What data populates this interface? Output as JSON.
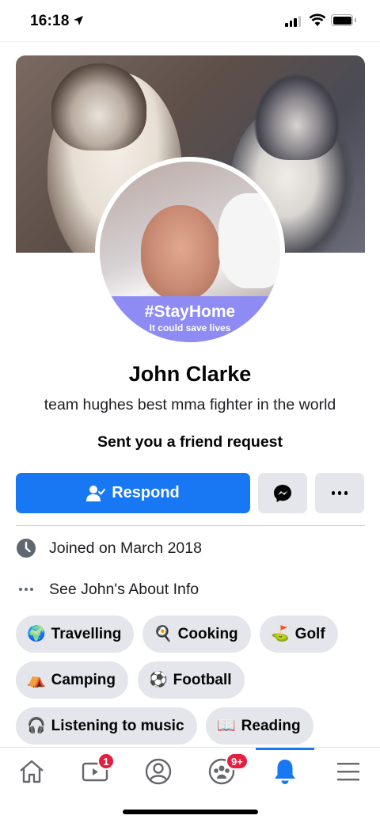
{
  "status_bar": {
    "time": "16:18"
  },
  "cover": {
    "image": "two-dogs-cover-photo"
  },
  "profile_frame": {
    "title": "#StayHome",
    "subtitle": "It could save lives"
  },
  "profile": {
    "name": "John Clarke",
    "bio": "team hughes best mma fighter in the world",
    "request_text": "Sent you a friend request"
  },
  "actions": {
    "respond_label": "Respond"
  },
  "info": {
    "joined": "Joined on March 2018",
    "about": "See John's About Info"
  },
  "interests": [
    {
      "label": "Travelling",
      "emoji": "🌍"
    },
    {
      "label": "Cooking",
      "emoji": "🍳"
    },
    {
      "label": "Golf",
      "emoji": "⛳"
    },
    {
      "label": "Camping",
      "emoji": "⛺"
    },
    {
      "label": "Football",
      "emoji": "⚽"
    },
    {
      "label": "Listening to music",
      "emoji": "🎧"
    },
    {
      "label": "Reading",
      "emoji": "📖"
    }
  ],
  "tab_bar": {
    "tabs": [
      "home",
      "watch",
      "profile",
      "groups",
      "notifications",
      "menu"
    ],
    "active": "notifications",
    "watch_badge": "1",
    "groups_badge": "9+"
  },
  "colors": {
    "accent": "#1877f2",
    "badge": "#e41e3f",
    "frame": "#8e8bf5"
  }
}
